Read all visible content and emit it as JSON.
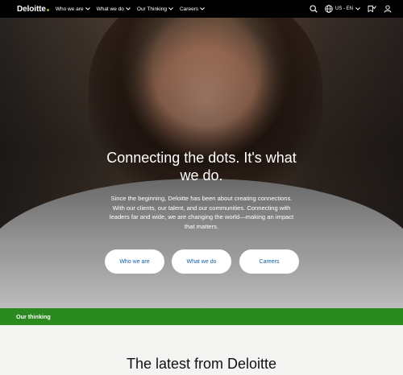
{
  "nav": {
    "logo": "Deloitte",
    "items": [
      {
        "label": "Who we are"
      },
      {
        "label": "What we do"
      },
      {
        "label": "Our Thinking"
      },
      {
        "label": "Careers"
      }
    ],
    "language": "US - EN",
    "icons": [
      "search-icon",
      "globe-icon",
      "bookmark-icon",
      "user-icon"
    ]
  },
  "hero": {
    "title": "Connecting the dots. It's what we do.",
    "body": "Since the beginning, Deloitte has been about creating connections. With our clients, our talent, and our communities. Connecting with leaders far and wide, we are changing the world—making an impact that matters.",
    "buttons": [
      {
        "label": "Who we are"
      },
      {
        "label": "What we do"
      },
      {
        "label": "Careers"
      }
    ]
  },
  "thinking_bar": {
    "label": "Our thinking"
  },
  "latest": {
    "title": "The latest from Deloitte"
  },
  "colors": {
    "brand_green": "#86bc25",
    "bar_green": "#2a8a1f",
    "button_text": "#0f5fa8"
  }
}
